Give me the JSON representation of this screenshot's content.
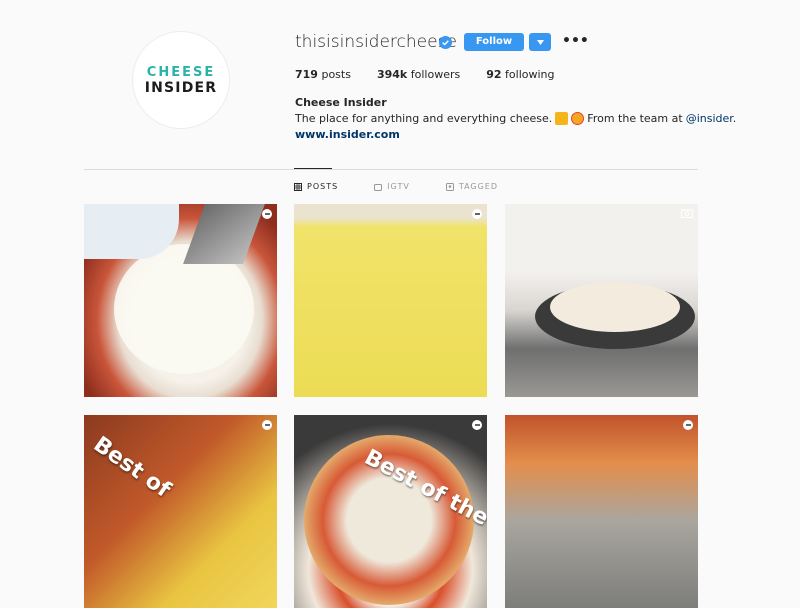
{
  "profile": {
    "logo_line1": "CHEESE",
    "logo_line2": "INSIDER",
    "username": "thisisinsidercheese",
    "verified_icon": "verified-badge-icon",
    "follow_label": "Follow",
    "more_icon_text": "•••"
  },
  "stats": {
    "posts_count": "719",
    "posts_label": "posts",
    "followers_count": "394k",
    "followers_label": "followers",
    "following_count": "92",
    "following_label": "following"
  },
  "bio": {
    "name": "Cheese Insider",
    "text_before": "The place for anything and everything cheese.",
    "text_after": "From the team at",
    "mention": "@insider",
    "mention_suffix": ".",
    "link": "www.insider.com"
  },
  "tabs": [
    {
      "label": "POSTS",
      "icon": "grid-icon",
      "active": true
    },
    {
      "label": "IGTV",
      "icon": "tv-icon",
      "active": false
    },
    {
      "label": "TAGGED",
      "icon": "tag-icon",
      "active": false
    }
  ],
  "posts": {
    "overlay_1": "Best of",
    "overlay_2": "Best of the B"
  },
  "colors": {
    "accent": "#3897f0",
    "teal": "#2ab3a7",
    "link": "#003569",
    "background": "#fafafa"
  }
}
